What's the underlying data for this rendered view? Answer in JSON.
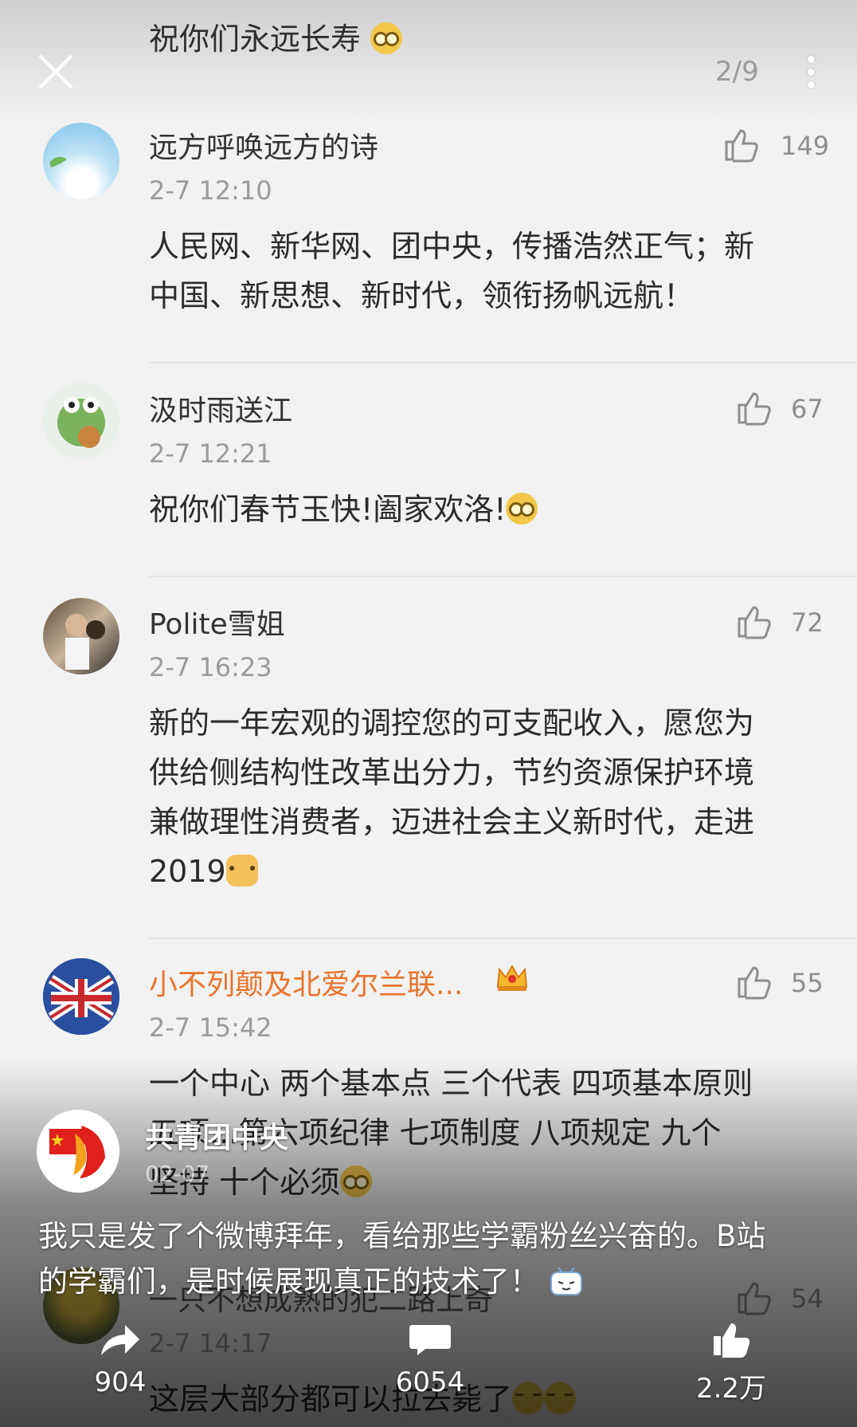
{
  "header": {
    "top_text": "祝你们永远长寿",
    "page_indicator": "2/9"
  },
  "comments": [
    {
      "username": "远方呼唤远方的诗",
      "time": "2-7 12:10",
      "likes": "149",
      "lines": [
        "人民网、新华网、团中央，传播浩然正气；新",
        "中国、新思想、新时代，领衔扬帆远航！"
      ]
    },
    {
      "username": "汲时雨送江",
      "time": "2-7 12:21",
      "likes": "67",
      "lines": [
        "祝你们春节玉快!阖家欢洛!"
      ]
    },
    {
      "username": "Polite雪姐",
      "time": "2-7 16:23",
      "likes": "72",
      "lines": [
        "新的一年宏观的调控您的可支配收入，愿您为",
        "供给侧结构性改革出分力，节约资源保护环境",
        "兼做理性消费者，迈进社会主义新时代，走进",
        "2019"
      ]
    },
    {
      "username": "小不列颠及北爱尔兰联...",
      "time": "2-7 15:42",
      "likes": "55",
      "lines": [
        "一个中心 两个基本点 三个代表 四项基本原则",
        "五项...第六项纪律 七项制度 八项规定 九个",
        "坚持 十个必须"
      ]
    },
    {
      "username": "一只不想成熟的犯二路上奇",
      "time": "2-7 14:17",
      "likes": "54",
      "lines": [
        "这层大部分都可以拉去毙了"
      ]
    }
  ],
  "post": {
    "poster_name": "共青团中央",
    "date": "02-07",
    "text_line1": "我只是发了个微博拜年，看给那些学霸粉丝兴奋的。B站",
    "text_line2": "的学霸们，是时候展现真正的技术了！"
  },
  "actions": {
    "share_count": "904",
    "comment_count": "6054",
    "like_count": "2.2万"
  },
  "colors": {
    "vip_name": "#e9742b",
    "muted": "#9b9b9b"
  }
}
